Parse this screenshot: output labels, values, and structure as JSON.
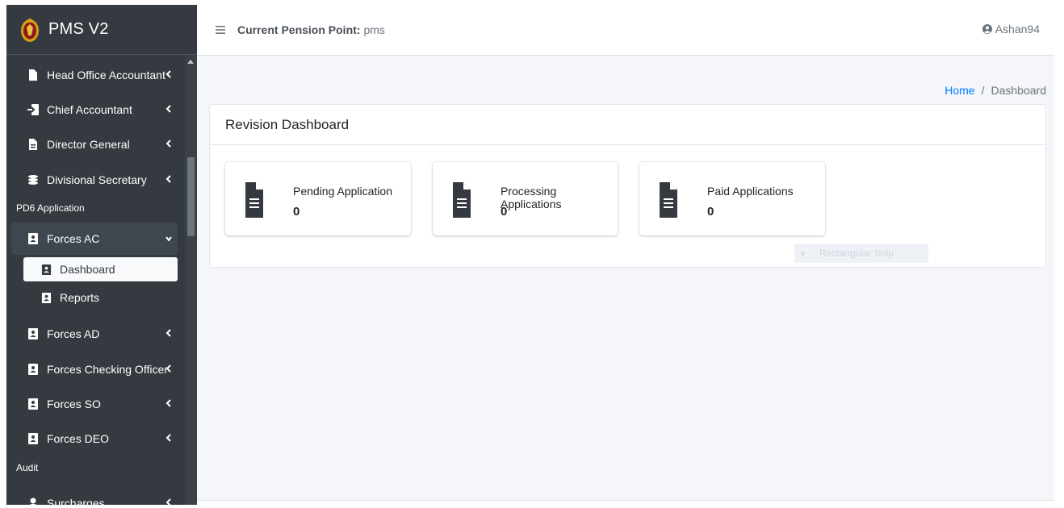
{
  "brand": {
    "title": "PMS V2"
  },
  "topbar": {
    "pension_label": "Current Pension Point:",
    "pension_value": "pms",
    "username": "Ashan94"
  },
  "sidebar": {
    "items": [
      {
        "label": "Head Office Accountant",
        "icon": "file-icon"
      },
      {
        "label": "Chief Accountant",
        "icon": "sign-in-icon"
      },
      {
        "label": "Director General",
        "icon": "file-text-icon"
      },
      {
        "label": "Divisional Secretary",
        "icon": "coins-icon"
      }
    ],
    "section_pd6": "PD6 Application",
    "forces_ac": {
      "label": "Forces AC",
      "icon": "address-book-icon"
    },
    "sub_items": [
      {
        "label": "Dashboard",
        "icon": "address-book-icon"
      },
      {
        "label": "Reports",
        "icon": "address-book-icon"
      }
    ],
    "items2": [
      {
        "label": "Forces AD",
        "icon": "address-book-icon"
      },
      {
        "label": "Forces Checking Officer",
        "icon": "address-book-icon"
      },
      {
        "label": "Forces SO",
        "icon": "address-book-icon"
      },
      {
        "label": "Forces DEO",
        "icon": "address-book-icon"
      }
    ],
    "section_audit": "Audit",
    "surcharges": {
      "label": "Surcharges",
      "icon": "user-icon"
    }
  },
  "breadcrumb": {
    "home": "Home",
    "separator": "/",
    "current": "Dashboard"
  },
  "dashboard": {
    "title": "Revision Dashboard",
    "boxes": [
      {
        "label": "Pending Application",
        "value": "0",
        "icon": "document-icon"
      },
      {
        "label": "Processing Applications",
        "value": "0",
        "icon": "document-icon"
      },
      {
        "label": "Paid Applications",
        "value": "0",
        "icon": "document-icon"
      }
    ]
  },
  "overlay": {
    "snip_label": "Rectangular Snip"
  },
  "colors": {
    "sidebar_bg": "#343a40",
    "content_bg": "#f4f6f9",
    "link": "#007bff",
    "icon_dark": "#343a40"
  }
}
